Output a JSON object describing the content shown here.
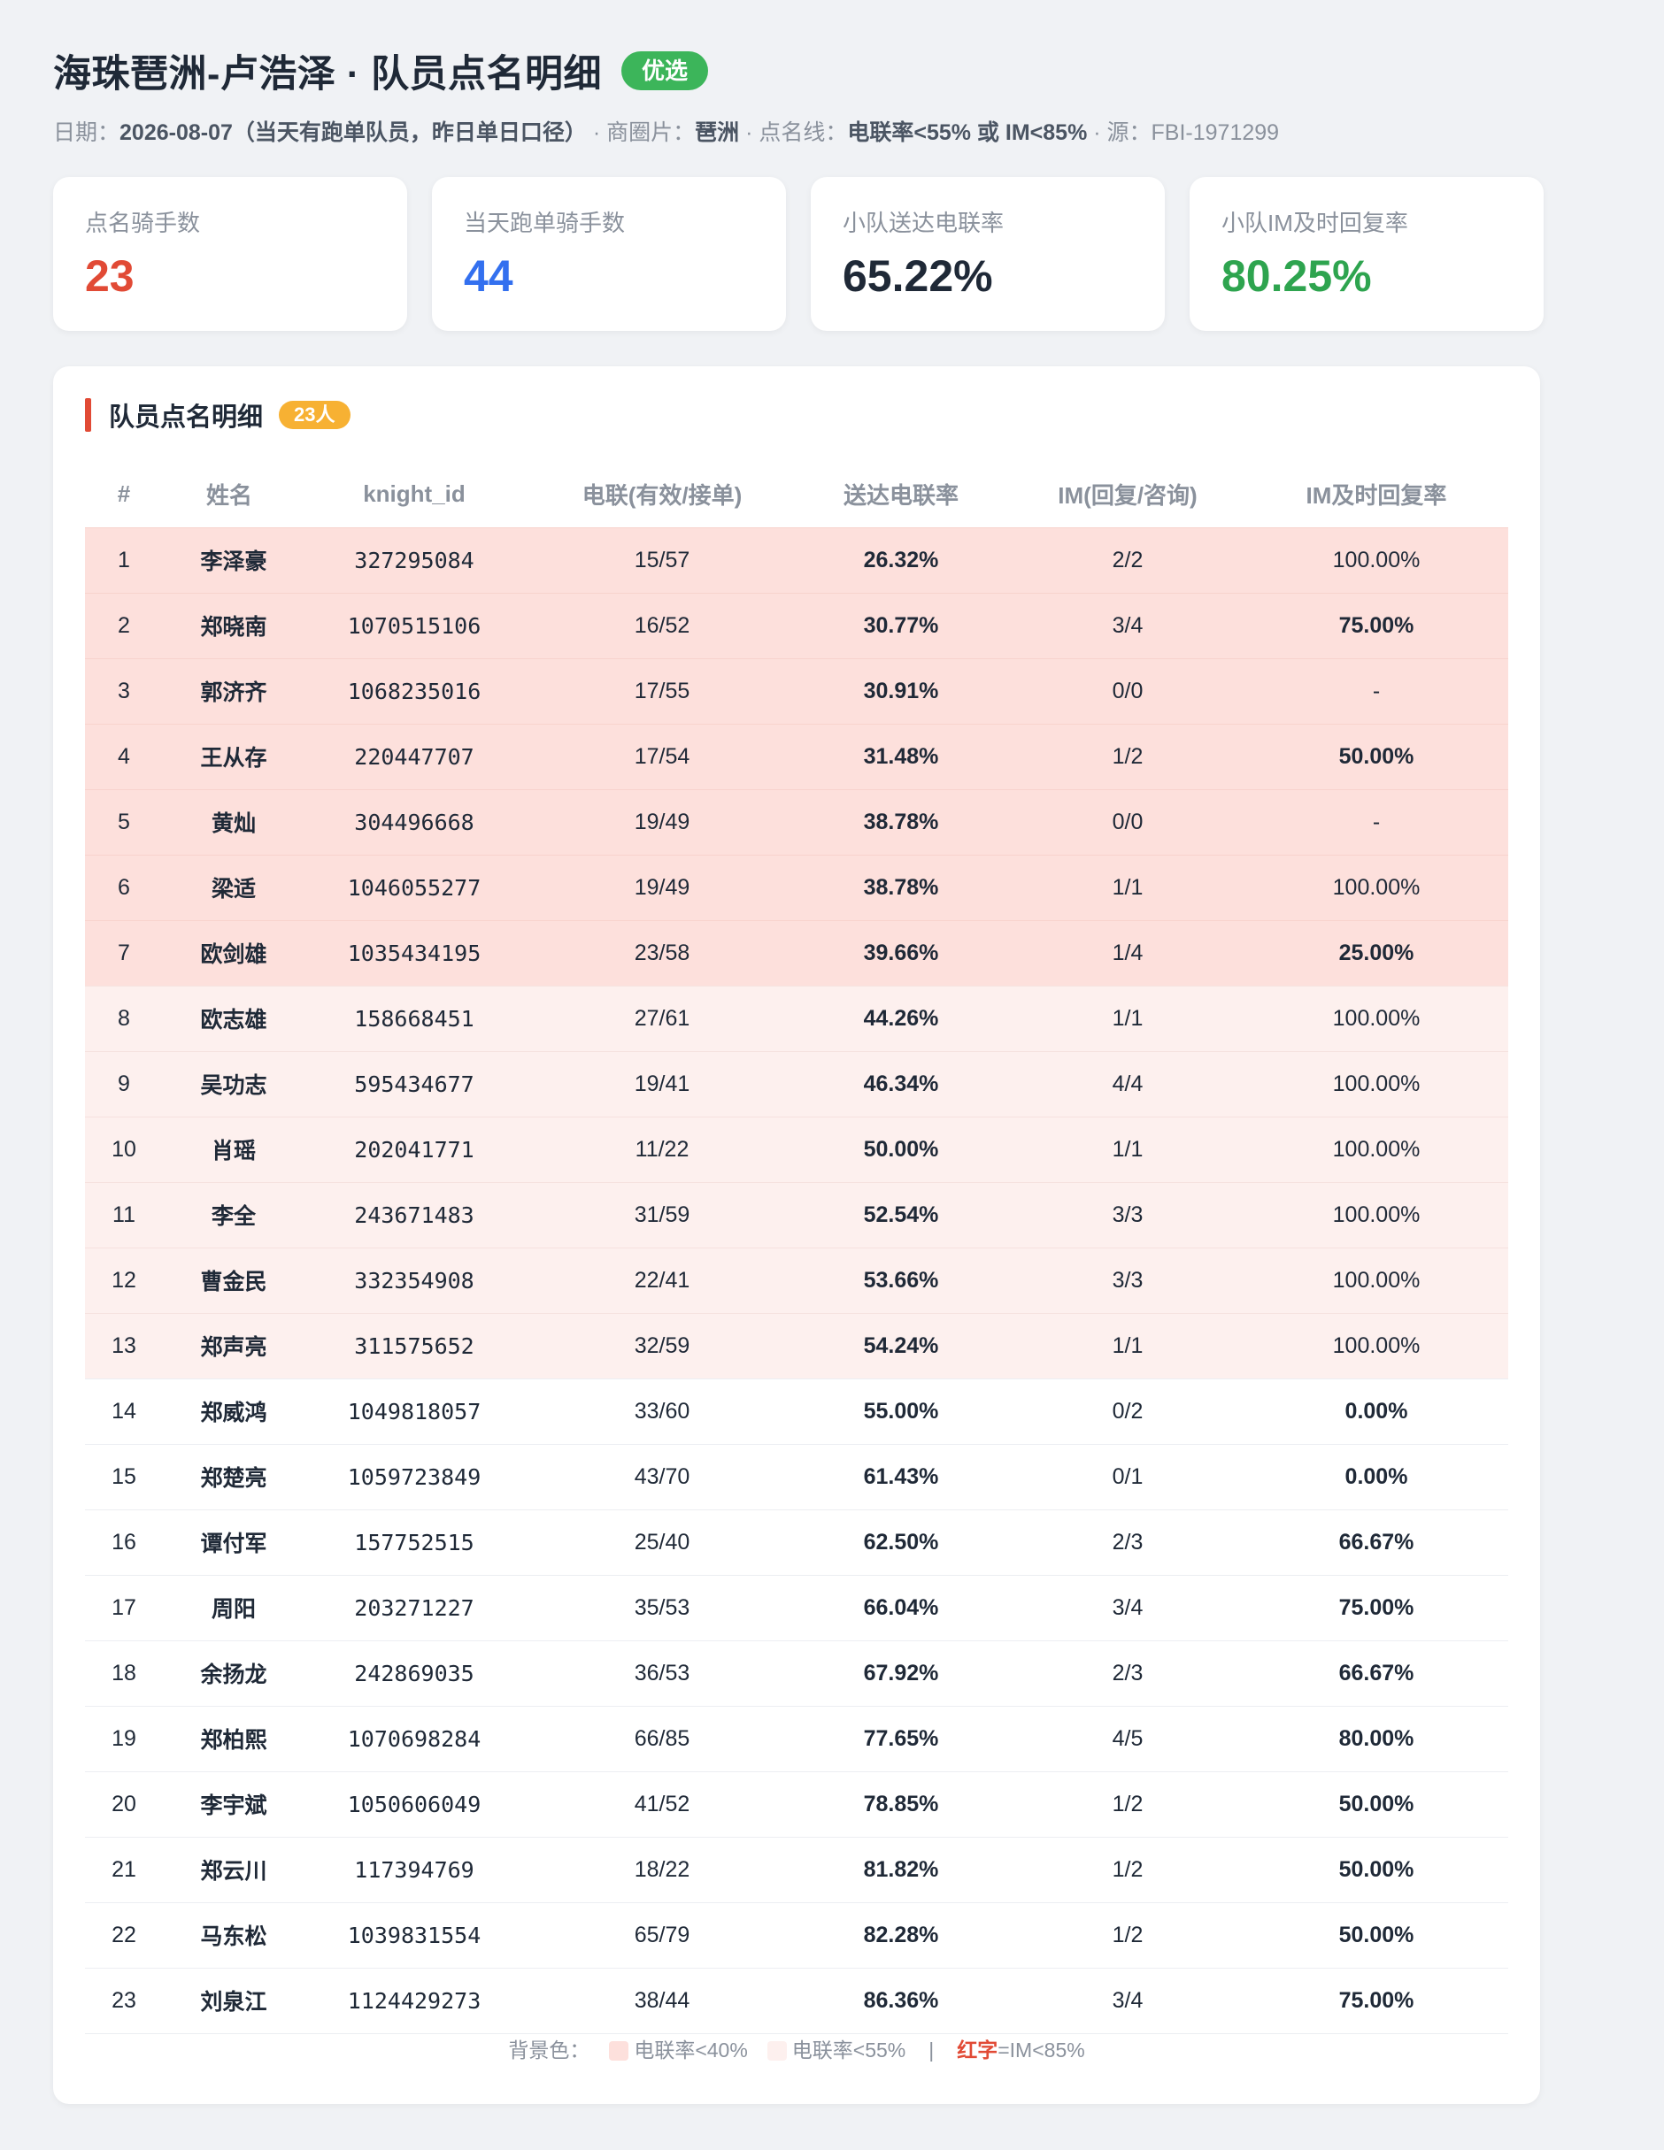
{
  "header": {
    "title": "海珠琶洲-卢浩泽 · 队员点名明细",
    "tag": "优选",
    "meta": {
      "date_label": "日期：",
      "date_value": "2026-08-07（当天有跑单队员，昨日单日口径）",
      "area_label": " · 商圈片：",
      "area_value": "琶洲",
      "line_label": " · 点名线：",
      "line_value": "电联率<55% 或 IM<85%",
      "source_text": " · 源：FBI-1971299"
    }
  },
  "colors": {
    "red": "#e14a35",
    "blue": "#3370ef",
    "dark": "#1f2937",
    "green": "#2ea44f",
    "badge_green": "#3cb55a",
    "badge_orange": "#f7b133",
    "row_low_bg": "#fde0dc",
    "row_mid_bg": "#fdf0ee"
  },
  "kpis": [
    {
      "label": "点名骑手数",
      "value": "23",
      "color": "#e14a35"
    },
    {
      "label": "当天跑单骑手数",
      "value": "44",
      "color": "#3370ef"
    },
    {
      "label": "小队送达电联率",
      "value": "65.22%",
      "color": "#1f2937"
    },
    {
      "label": "小队IM及时回复率",
      "value": "80.25%",
      "color": "#2ea44f"
    }
  ],
  "roster": {
    "title": "队员点名明细",
    "count_badge": "23人",
    "columns": [
      "#",
      "姓名",
      "knight_id",
      "电联(有效/接单)",
      "送达电联率",
      "IM(回复/咨询)",
      "IM及时回复率"
    ],
    "rows": [
      {
        "no": "1",
        "name": "李泽豪",
        "knight_id": "327295084",
        "calls": "15/57",
        "call_rate": "26.32%",
        "im": "2/2",
        "im_rate": "100.00%",
        "bg": "low",
        "im_warn": false
      },
      {
        "no": "2",
        "name": "郑晓南",
        "knight_id": "1070515106",
        "calls": "16/52",
        "call_rate": "30.77%",
        "im": "3/4",
        "im_rate": "75.00%",
        "bg": "low",
        "im_warn": true
      },
      {
        "no": "3",
        "name": "郭济齐",
        "knight_id": "1068235016",
        "calls": "17/55",
        "call_rate": "30.91%",
        "im": "0/0",
        "im_rate": "-",
        "bg": "low",
        "im_warn": false
      },
      {
        "no": "4",
        "name": "王从存",
        "knight_id": "220447707",
        "calls": "17/54",
        "call_rate": "31.48%",
        "im": "1/2",
        "im_rate": "50.00%",
        "bg": "low",
        "im_warn": true
      },
      {
        "no": "5",
        "name": "黄灿",
        "knight_id": "304496668",
        "calls": "19/49",
        "call_rate": "38.78%",
        "im": "0/0",
        "im_rate": "-",
        "bg": "low",
        "im_warn": false
      },
      {
        "no": "6",
        "name": "梁适",
        "knight_id": "1046055277",
        "calls": "19/49",
        "call_rate": "38.78%",
        "im": "1/1",
        "im_rate": "100.00%",
        "bg": "low",
        "im_warn": false
      },
      {
        "no": "7",
        "name": "欧剑雄",
        "knight_id": "1035434195",
        "calls": "23/58",
        "call_rate": "39.66%",
        "im": "1/4",
        "im_rate": "25.00%",
        "bg": "low",
        "im_warn": true
      },
      {
        "no": "8",
        "name": "欧志雄",
        "knight_id": "158668451",
        "calls": "27/61",
        "call_rate": "44.26%",
        "im": "1/1",
        "im_rate": "100.00%",
        "bg": "mid",
        "im_warn": false
      },
      {
        "no": "9",
        "name": "吴功志",
        "knight_id": "595434677",
        "calls": "19/41",
        "call_rate": "46.34%",
        "im": "4/4",
        "im_rate": "100.00%",
        "bg": "mid",
        "im_warn": false
      },
      {
        "no": "10",
        "name": "肖瑶",
        "knight_id": "202041771",
        "calls": "11/22",
        "call_rate": "50.00%",
        "im": "1/1",
        "im_rate": "100.00%",
        "bg": "mid",
        "im_warn": false
      },
      {
        "no": "11",
        "name": "李全",
        "knight_id": "243671483",
        "calls": "31/59",
        "call_rate": "52.54%",
        "im": "3/3",
        "im_rate": "100.00%",
        "bg": "mid",
        "im_warn": false
      },
      {
        "no": "12",
        "name": "曹金民",
        "knight_id": "332354908",
        "calls": "22/41",
        "call_rate": "53.66%",
        "im": "3/3",
        "im_rate": "100.00%",
        "bg": "mid",
        "im_warn": false
      },
      {
        "no": "13",
        "name": "郑声亮",
        "knight_id": "311575652",
        "calls": "32/59",
        "call_rate": "54.24%",
        "im": "1/1",
        "im_rate": "100.00%",
        "bg": "mid",
        "im_warn": false
      },
      {
        "no": "14",
        "name": "郑威鸿",
        "knight_id": "1049818057",
        "calls": "33/60",
        "call_rate": "55.00%",
        "im": "0/2",
        "im_rate": "0.00%",
        "bg": "",
        "im_warn": true
      },
      {
        "no": "15",
        "name": "郑楚亮",
        "knight_id": "1059723849",
        "calls": "43/70",
        "call_rate": "61.43%",
        "im": "0/1",
        "im_rate": "0.00%",
        "bg": "",
        "im_warn": true
      },
      {
        "no": "16",
        "name": "谭付军",
        "knight_id": "157752515",
        "calls": "25/40",
        "call_rate": "62.50%",
        "im": "2/3",
        "im_rate": "66.67%",
        "bg": "",
        "im_warn": true
      },
      {
        "no": "17",
        "name": "周阳",
        "knight_id": "203271227",
        "calls": "35/53",
        "call_rate": "66.04%",
        "im": "3/4",
        "im_rate": "75.00%",
        "bg": "",
        "im_warn": true
      },
      {
        "no": "18",
        "name": "余扬龙",
        "knight_id": "242869035",
        "calls": "36/53",
        "call_rate": "67.92%",
        "im": "2/3",
        "im_rate": "66.67%",
        "bg": "",
        "im_warn": true
      },
      {
        "no": "19",
        "name": "郑柏熙",
        "knight_id": "1070698284",
        "calls": "66/85",
        "call_rate": "77.65%",
        "im": "4/5",
        "im_rate": "80.00%",
        "bg": "",
        "im_warn": true
      },
      {
        "no": "20",
        "name": "李宇斌",
        "knight_id": "1050606049",
        "calls": "41/52",
        "call_rate": "78.85%",
        "im": "1/2",
        "im_rate": "50.00%",
        "bg": "",
        "im_warn": true
      },
      {
        "no": "21",
        "name": "郑云川",
        "knight_id": "117394769",
        "calls": "18/22",
        "call_rate": "81.82%",
        "im": "1/2",
        "im_rate": "50.00%",
        "bg": "",
        "im_warn": true
      },
      {
        "no": "22",
        "name": "马东松",
        "knight_id": "1039831554",
        "calls": "65/79",
        "call_rate": "82.28%",
        "im": "1/2",
        "im_rate": "50.00%",
        "bg": "",
        "im_warn": true
      },
      {
        "no": "23",
        "name": "刘泉江",
        "knight_id": "1124429273",
        "calls": "38/44",
        "call_rate": "86.36%",
        "im": "3/4",
        "im_rate": "75.00%",
        "bg": "",
        "im_warn": true
      }
    ]
  },
  "legend": {
    "prefix": "背景色：",
    "low_label": "电联率<40%",
    "mid_label": "电联率<55%",
    "separator": "|",
    "red_text": "红字",
    "red_suffix": "=IM<85%"
  }
}
